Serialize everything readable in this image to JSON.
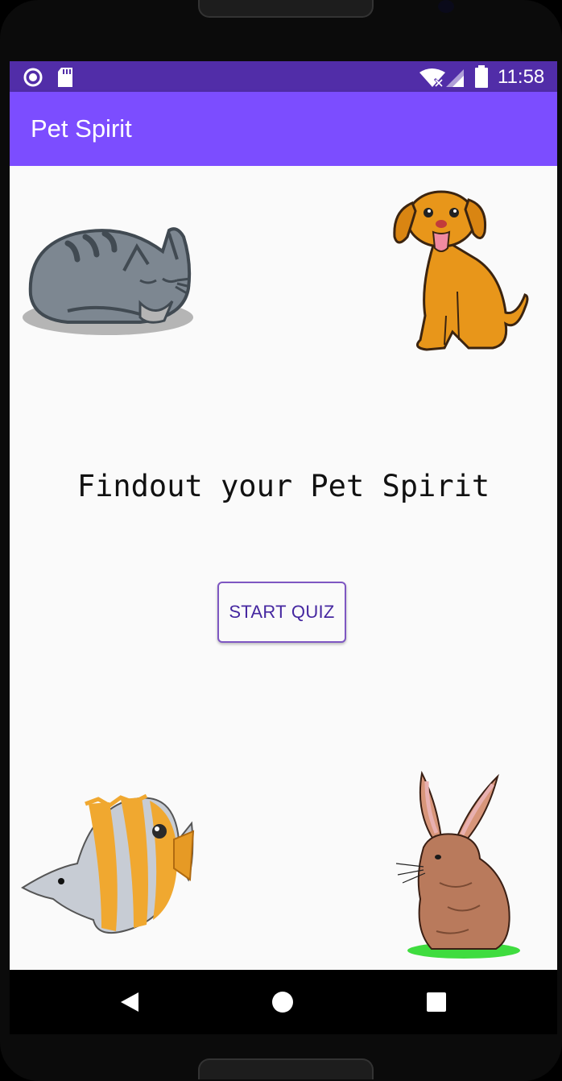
{
  "status_bar": {
    "time": "11:58",
    "left_icons": [
      "circle-icon",
      "sd-card-icon"
    ],
    "right_icons": [
      "wifi-off-icon",
      "signal-icon",
      "battery-icon"
    ]
  },
  "app_bar": {
    "title": "Pet Spirit"
  },
  "main": {
    "headline": "Findout your Pet Spirit",
    "start_button_label": "START QUIZ",
    "images": [
      "cat-image",
      "dog-image",
      "fish-image",
      "rabbit-image"
    ]
  },
  "nav_bar": {
    "icons": [
      "back-icon",
      "home-icon",
      "recents-icon"
    ]
  },
  "colors": {
    "status_bar": "#512da8",
    "app_bar": "#7c4dff",
    "button_text": "#4527a0",
    "button_border": "#7e57c2",
    "background": "#fafafa"
  }
}
